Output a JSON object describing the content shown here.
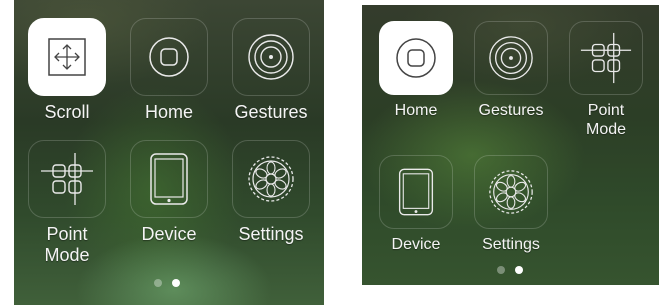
{
  "left_panel": {
    "items": [
      {
        "label": "Scroll",
        "icon": "scroll-icon",
        "active": true
      },
      {
        "label": "Home",
        "icon": "home-icon",
        "active": false
      },
      {
        "label": "Gestures",
        "icon": "gestures-icon",
        "active": false
      },
      {
        "label": "Point\nMode",
        "icon": "point-mode-icon",
        "active": false
      },
      {
        "label": "Device",
        "icon": "device-icon",
        "active": false
      },
      {
        "label": "Settings",
        "icon": "settings-icon",
        "active": false
      }
    ],
    "page_indicator": {
      "pages": 2,
      "current": 2
    }
  },
  "right_panel": {
    "items": [
      {
        "label": "Home",
        "icon": "home-icon",
        "active": true
      },
      {
        "label": "Gestures",
        "icon": "gestures-icon",
        "active": false
      },
      {
        "label": "Point\nMode",
        "icon": "point-mode-icon",
        "active": false
      },
      {
        "label": "Device",
        "icon": "device-icon",
        "active": false
      },
      {
        "label": "Settings",
        "icon": "settings-icon",
        "active": false
      }
    ],
    "page_indicator": {
      "pages": 2,
      "current": 2
    }
  },
  "colors": {
    "active_tile": "#ffffff",
    "label": "#f4f4f4"
  }
}
